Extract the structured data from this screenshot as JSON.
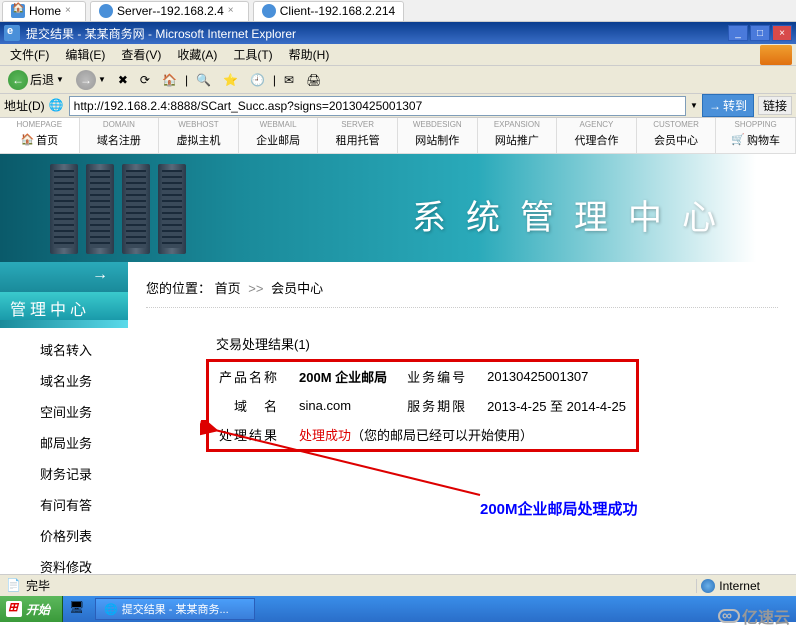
{
  "browser_tabs": [
    {
      "label": "Home",
      "icon": "home"
    },
    {
      "label": "Server--192.168.2.4",
      "icon": "globe"
    },
    {
      "label": "Client--192.168.2.214",
      "icon": "globe",
      "active": true
    }
  ],
  "ie": {
    "title": "提交结果 - 某某商务网 - Microsoft Internet Explorer",
    "menus": [
      "文件(F)",
      "编辑(E)",
      "查看(V)",
      "收藏(A)",
      "工具(T)",
      "帮助(H)"
    ],
    "back_label": "后退",
    "address_label": "地址(D)",
    "address_value": "http://192.168.2.4:8888/SCart_Succ.asp?signs=20130425001307",
    "go_label": "转到",
    "links_label": "链接"
  },
  "nav": [
    {
      "sub": "HOMEPAGE",
      "main": "首页",
      "icon": "🏠"
    },
    {
      "sub": "DOMAIN",
      "main": "域名注册"
    },
    {
      "sub": "WEBHOST",
      "main": "虚拟主机"
    },
    {
      "sub": "WEBMAIL",
      "main": "企业邮局"
    },
    {
      "sub": "SERVER",
      "main": "租用托管"
    },
    {
      "sub": "WEBDESIGN",
      "main": "网站制作"
    },
    {
      "sub": "EXPANSION",
      "main": "网站推广"
    },
    {
      "sub": "AGENCY",
      "main": "代理合作"
    },
    {
      "sub": "CUSTOMER",
      "main": "会员中心"
    },
    {
      "sub": "SHOPPING",
      "main": "购物车",
      "icon": "🛒"
    }
  ],
  "banner_title": "系统管理中心",
  "sidebar": {
    "title": "管理中心",
    "items": [
      "域名转入",
      "域名业务",
      "空间业务",
      "邮局业务",
      "财务记录",
      "有问有答",
      "价格列表",
      "资料修改"
    ]
  },
  "breadcrumb": {
    "label": "您的位置：",
    "home": "首页",
    "sep": ">>",
    "current": "会员中心"
  },
  "result": {
    "title": "交易处理结果(1)",
    "rows": [
      {
        "l1": "产品名称",
        "v1": "200M 企业邮局",
        "l2": "业务编号",
        "v2": "20130425001307"
      },
      {
        "l1": "域　名",
        "v1": "sina.com",
        "l2": "服务期限",
        "v2": "2013-4-25 至 2014-4-25"
      },
      {
        "l1": "处理结果",
        "v1_red": "处理成功",
        "v1_rest": "（您的邮局已经可以开始使用）"
      }
    ]
  },
  "annotation": "200M企业邮局处理成功",
  "status": {
    "done": "完毕",
    "zone": "Internet"
  },
  "taskbar": {
    "start": "开始",
    "task": "提交结果 - 某某商务..."
  },
  "watermark": "亿速云"
}
